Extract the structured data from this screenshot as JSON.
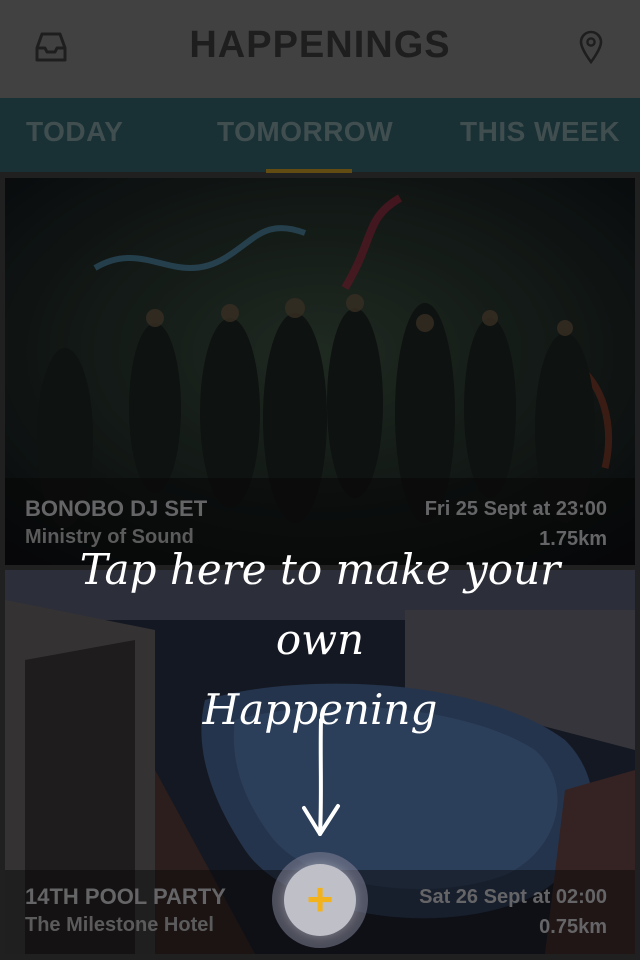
{
  "header": {
    "title": "HAPPENINGS",
    "left_icon": "inbox-icon",
    "right_icon": "location-pin-icon"
  },
  "tabs": [
    {
      "label": "TODAY",
      "selected": false
    },
    {
      "label": "TOMORROW",
      "selected": true
    },
    {
      "label": "THIS WEEK",
      "selected": false
    }
  ],
  "events": [
    {
      "name": "BONOBO DJ SET",
      "venue": "Ministry of Sound",
      "date": "Fri 25 Sept at 23:00",
      "distance": "1.75km",
      "image": "dancers-at-night"
    },
    {
      "name": "14TH POOL PARTY",
      "venue": "The Milestone Hotel",
      "date": "Sat 26 Sept at 02:00",
      "distance": "0.75km",
      "image": "rooftop-pool-at-night"
    }
  ],
  "tutorial": {
    "line1": "Tap here to make your own",
    "line2": "Happening",
    "arrow_icon": "down-arrow-icon"
  },
  "fab": {
    "label": "+",
    "icon": "plus-icon"
  },
  "colors": {
    "accent": "#f2b21c",
    "tab_bar": "#23444a",
    "header": "#5a5a5c"
  }
}
